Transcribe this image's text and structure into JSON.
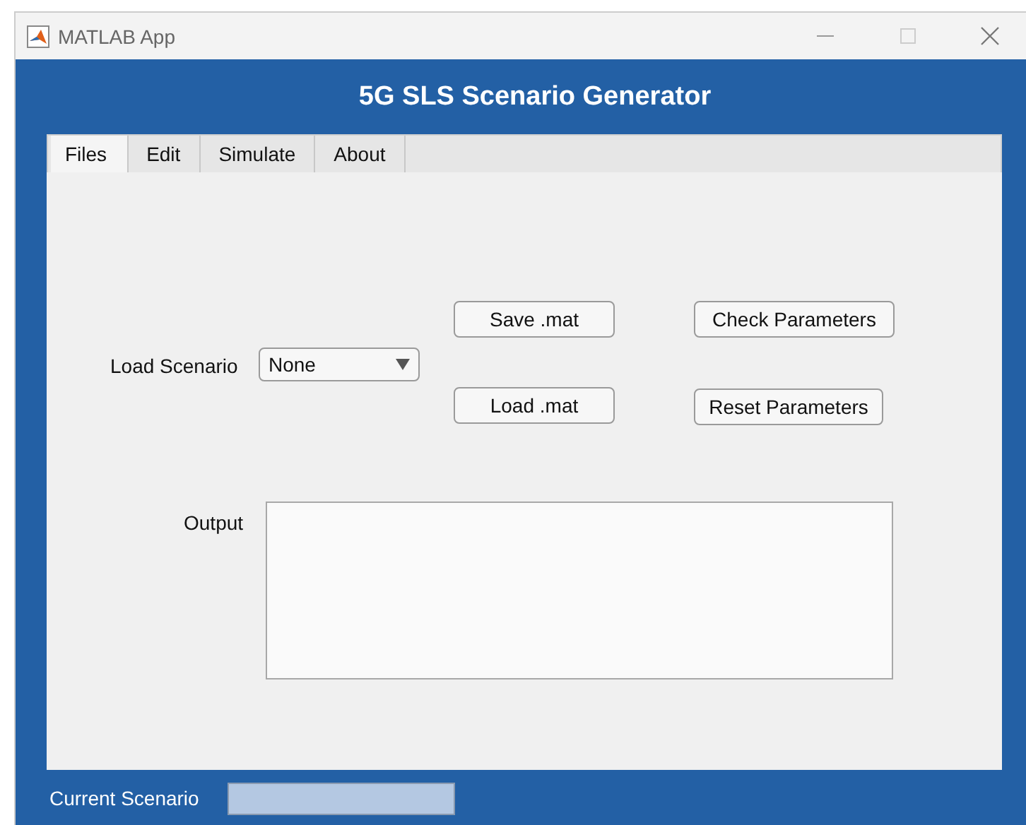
{
  "window": {
    "title": "MATLAB App"
  },
  "header": {
    "title": "5G SLS Scenario Generator"
  },
  "tabs": [
    {
      "label": "Files",
      "selected": true
    },
    {
      "label": "Edit",
      "selected": false
    },
    {
      "label": "Simulate",
      "selected": false
    },
    {
      "label": "About",
      "selected": false
    }
  ],
  "files_tab": {
    "load_scenario": {
      "label": "Load Scenario",
      "value": "None"
    },
    "buttons": [
      {
        "label": "Save .mat"
      },
      {
        "label": "Check Parameters"
      },
      {
        "label": "Load .mat"
      },
      {
        "label": "Reset Parameters"
      }
    ],
    "output": {
      "label": "Output"
    }
  },
  "status_bar": {
    "label": "Current Scenario"
  }
}
